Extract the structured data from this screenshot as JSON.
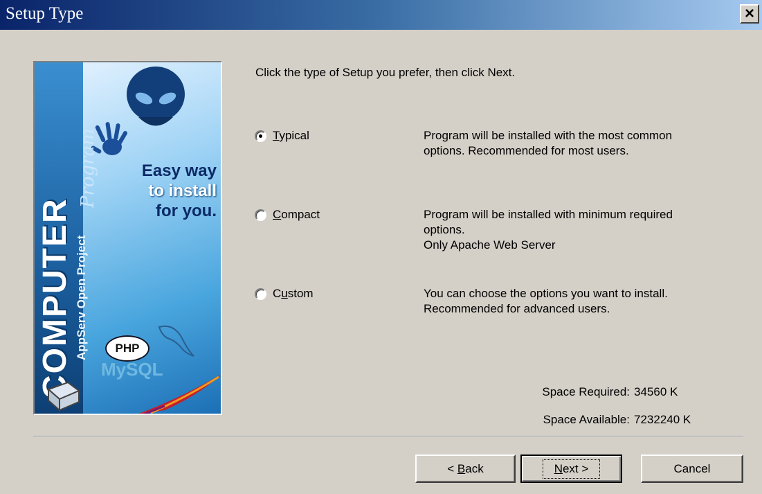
{
  "window": {
    "title": "Setup Type",
    "close_label": "×"
  },
  "banner": {
    "brand_text": "COMPUTER",
    "program_text": "Program",
    "project_text": "AppServ Open Project",
    "tagline_1": "Easy way",
    "tagline_2": "to install",
    "tagline_3": "for you.",
    "php_text": "PHP",
    "mysql_text": "MySQL"
  },
  "instruction": "Click the type of Setup you prefer, then click Next.",
  "options": [
    {
      "accel": "T",
      "rest": "ypical",
      "selected": true,
      "description": [
        "Program will be installed with the most common",
        "options. Recommended for most users."
      ]
    },
    {
      "accel": "C",
      "rest": "ompact",
      "selected": false,
      "description": [
        "Program will be installed with minimum required",
        "options.",
        "Only Apache Web Server"
      ]
    },
    {
      "pre": "C",
      "accel": "u",
      "rest": "stom",
      "selected": false,
      "description": [
        "You can choose the options you want to install.",
        "Recommended for advanced users."
      ]
    }
  ],
  "space": {
    "required_label": "Space Required:",
    "required_value": "34560 K",
    "available_label": "Space Available:",
    "available_value": "7232240 K"
  },
  "buttons": {
    "back_prefix": "< ",
    "back_accel": "B",
    "back_rest": "ack",
    "next_accel": "N",
    "next_rest": "ext >",
    "cancel": "Cancel"
  }
}
